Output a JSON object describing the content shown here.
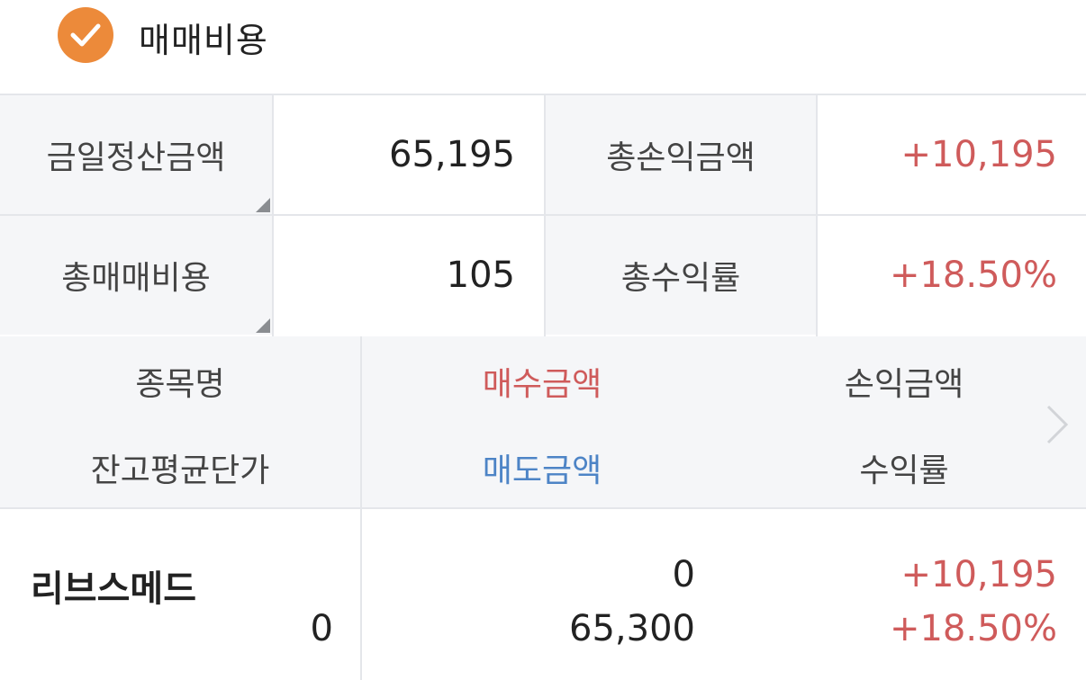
{
  "header": {
    "title": "매매비용",
    "icon": "check-circle-icon",
    "accent": "#ec8a3a"
  },
  "summary": {
    "settlement_label": "금일정산금액",
    "settlement_value": "65,195",
    "total_pl_label": "총손익금액",
    "total_pl_value": "+10,195",
    "total_cost_label": "총매매비용",
    "total_cost_value": "105",
    "total_return_label": "총수익률",
    "total_return_value": "+18.50%"
  },
  "columns": {
    "stock_name": "종목명",
    "avg_price": "잔고평균단가",
    "buy_amount": "매수금액",
    "sell_amount": "매도금액",
    "pl_amount": "손익금액",
    "return_rate": "수익률"
  },
  "rows": [
    {
      "name": "리브스메드",
      "avg_price": "0",
      "buy_amount": "0",
      "sell_amount": "65,300",
      "pl_amount": "+10,195",
      "return_rate": "+18.50%"
    }
  ],
  "colors": {
    "positive": "#cf5b5b",
    "buy": "#cf5b5b",
    "sell": "#4d84c6"
  }
}
